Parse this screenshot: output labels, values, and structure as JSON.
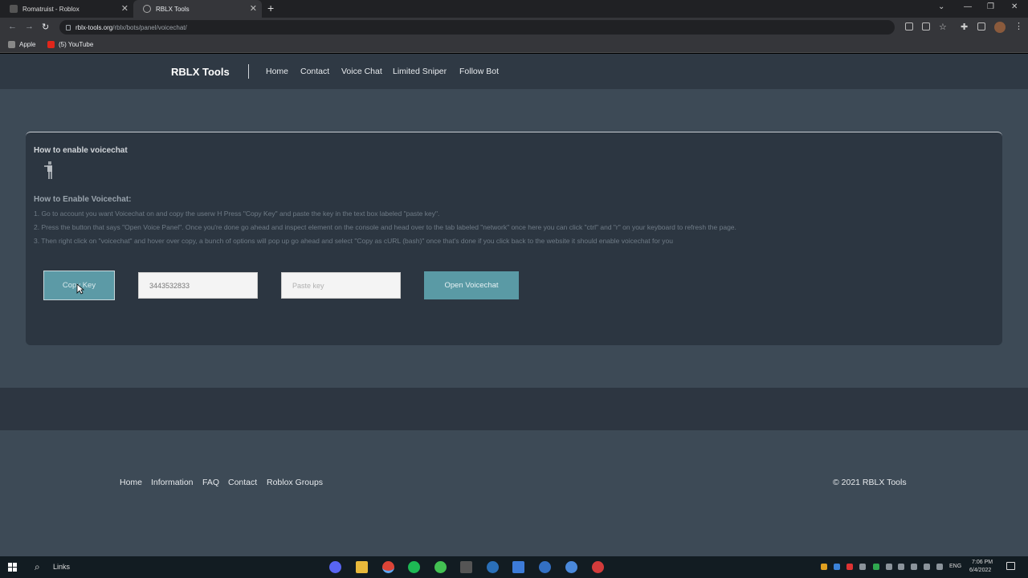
{
  "browser": {
    "tabs": [
      {
        "title": "Romatruist - Roblox"
      },
      {
        "title": "RBLX Tools",
        "active": true
      }
    ],
    "new_tab_label": "+",
    "url_host": "rblx-tools.org",
    "url_path": "/rblx/bots/panel/voicechat/",
    "bookmarks": [
      {
        "label": "Apple"
      },
      {
        "label": "(5) YouTube"
      }
    ]
  },
  "site": {
    "brand": "RBLX Tools",
    "nav": [
      "Home",
      "Contact",
      "Voice Chat",
      "Limited Sniper",
      "Follow Bot"
    ]
  },
  "card": {
    "title": "How to enable voicechat",
    "subtitle": "How to Enable Voicechat:",
    "steps": [
      "1. Go to account you want Voicechat on and copy the userw H Press \"Copy Key\" and paste the key in the text box labeled \"paste key\".",
      "2. Press the button that says \"Open Voice Panel\". Once you're done go ahead and inspect element on the console and head over to the tab labeled \"network\" once here you can click \"ctrl\" and \"r\" on your keyboard to refresh the page.",
      "3. Then right click on \"voicechat\" and hover over copy, a bunch of options will pop up go ahead and select \"Copy as cURL (bash)\" once that's done if you click back to the website it should enable voicechat for you"
    ],
    "copy_key_label": "Copy Key",
    "id_value": "3443532833",
    "paste_placeholder": "Paste key",
    "open_voicechat_label": "Open Voicechat"
  },
  "footer": {
    "links": [
      "Home",
      "Information",
      "FAQ",
      "Contact",
      "Roblox Groups"
    ],
    "copyright": "© 2021 RBLX Tools"
  },
  "taskbar": {
    "search_label": "Links",
    "lang": "ENG",
    "time": "7:06 PM",
    "date": "6/4/2022"
  },
  "colors": {
    "page_bg": "#3d4a56",
    "nav_bg": "#2f3944",
    "card_bg": "#2c3641",
    "accent_button": "#5a9aa5"
  }
}
